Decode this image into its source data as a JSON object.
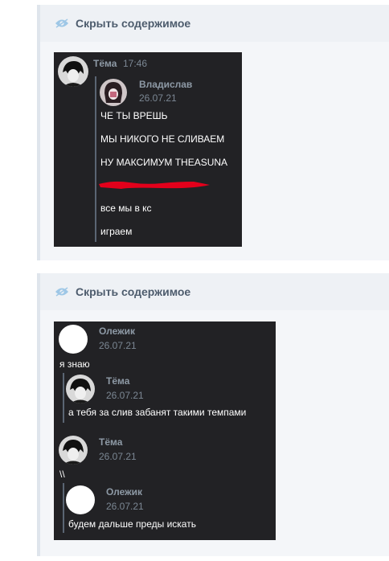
{
  "spoiler_label": "Скрыть содержимое",
  "spoilers": [
    {
      "label": "Скрыть содержимое",
      "author": {
        "name": "Тёма",
        "time": "17:46"
      },
      "quote": {
        "name": "Владислав",
        "date": "26.07.21",
        "lines": [
          "ЧЕ ТЫ ВРЕШЬ",
          "МЫ НИКОГО НЕ СЛИВАЕМ",
          "НУ МАКСИМУМ THEASUNA",
          "все мы в кс",
          "играем"
        ]
      }
    },
    {
      "label": "Скрыть содержимое",
      "messages": [
        {
          "name": "Олежик",
          "date": "26.07.21",
          "text": "я знаю"
        },
        {
          "quote_name": "Тёма",
          "quote_date": "26.07.21",
          "quote_text": "а тебя за слив забанят такими темпами"
        },
        {
          "name": "Тёма",
          "date": "26.07.21",
          "text": "\\\\"
        },
        {
          "quote_name": "Олежик",
          "quote_date": "26.07.21",
          "quote_text": "будем дальше преды искать"
        }
      ]
    }
  ],
  "colors": {
    "accent_eye": "#9ec7e6",
    "redaction": "#e3001b",
    "dark_bg": "#222225"
  }
}
